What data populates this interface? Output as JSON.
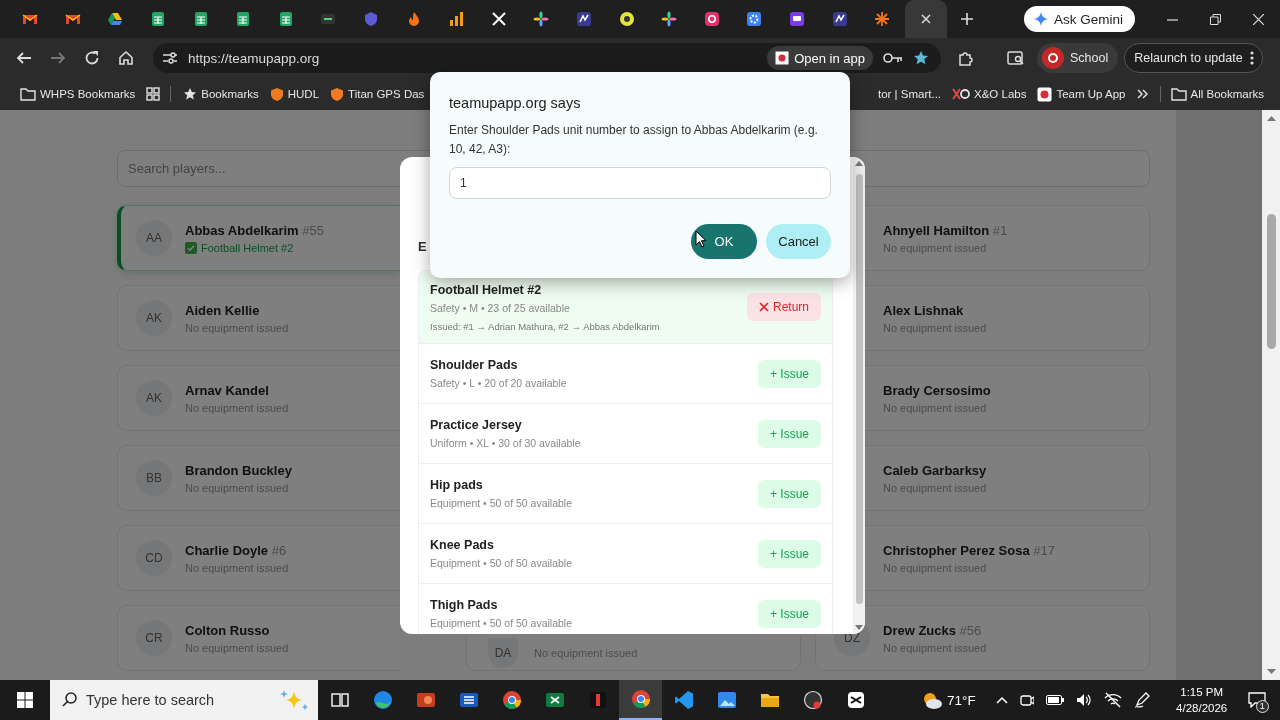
{
  "browser": {
    "tabs": [
      {
        "kind": "gmail",
        "selected": false
      },
      {
        "kind": "gmail",
        "selected": false
      },
      {
        "kind": "drive",
        "selected": false
      },
      {
        "kind": "sheets",
        "selected": false
      },
      {
        "kind": "sheets",
        "selected": false
      },
      {
        "kind": "sheets",
        "selected": false
      },
      {
        "kind": "sheets",
        "selected": false
      },
      {
        "kind": "dash",
        "selected": false
      },
      {
        "kind": "shield",
        "selected": false
      },
      {
        "kind": "flame",
        "selected": false
      },
      {
        "kind": "bars",
        "selected": false
      },
      {
        "kind": "x",
        "selected": false
      },
      {
        "kind": "pinwheel",
        "selected": false
      },
      {
        "kind": "badge",
        "selected": false
      },
      {
        "kind": "lemon",
        "selected": false
      },
      {
        "kind": "pinwheel",
        "selected": false
      },
      {
        "kind": "instagram",
        "selected": false
      },
      {
        "kind": "gear",
        "selected": false
      },
      {
        "kind": "chat",
        "selected": false
      },
      {
        "kind": "badge",
        "selected": false
      },
      {
        "kind": "burst",
        "selected": false
      },
      {
        "kind": "blank",
        "selected": true
      }
    ],
    "gemini": "Ask Gemini",
    "url": "https://teamupapp.org",
    "open_in_app": "Open in app",
    "profile": "School",
    "relaunch": "Relaunch to update",
    "bookmarks": [
      {
        "kind": "folder",
        "label": "WHPS Bookmarks"
      },
      {
        "kind": "apps"
      },
      {
        "kind": "star",
        "label": "Bookmarks"
      },
      {
        "kind": "shield",
        "label": "HUDL"
      },
      {
        "kind": "shield",
        "label": "Titan GPS Das"
      },
      {
        "kind": "plain",
        "label": "tor | Smart..."
      },
      {
        "kind": "xo",
        "label": "X&O Labs"
      },
      {
        "kind": "site",
        "label": "Team Up App"
      }
    ],
    "all_bookmarks": "All Bookmarks"
  },
  "page": {
    "search": {
      "placeholder": "Search players..."
    },
    "player_columns": [
      {
        "players": [
          {
            "initials": "AA",
            "name": "Abbas Abdelkarim",
            "number": "#55",
            "issued": "Football Helmet #2",
            "selected": true
          },
          {
            "initials": "AK",
            "name": "Aiden Kellie",
            "status": "No equipment issued",
            "selected": false
          },
          {
            "initials": "AK",
            "name": "Arnav Kandel",
            "status": "No equipment issued",
            "selected": false
          },
          {
            "initials": "BB",
            "name": "Brandon Buckley",
            "status": "No equipment issued",
            "selected": false
          },
          {
            "initials": "CD",
            "name": "Charlie Doyle",
            "number": "#6",
            "status": "No equipment issued",
            "selected": false
          },
          {
            "initials": "CR",
            "name": "Colton Russo",
            "status": "No equipment issued",
            "selected": false
          }
        ]
      },
      {
        "players": [
          {
            "initials": "DA",
            "status": "No equipment issued",
            "selected": false
          }
        ]
      },
      {
        "players": [
          {
            "name": "Ahnyell Hamilton",
            "number": "#1",
            "status": "No equipment issued"
          },
          {
            "name": "Alex Lishnak",
            "status": "No equipment issued"
          },
          {
            "name": "Brady Cersosimo",
            "status": "No equipment issued"
          },
          {
            "name": "Caleb Garbarksy",
            "status": "No equipment issued"
          },
          {
            "name": "Christopher Perez Sosa",
            "number": "#17",
            "status": "No equipment issued"
          },
          {
            "initials": "DZ",
            "name": "Drew Zucks",
            "number": "#56",
            "status": "No equipment issued"
          }
        ]
      }
    ]
  },
  "modal": {
    "heading": "E",
    "items": [
      {
        "name": "Football Helmet #2",
        "meta": "Safety • M • 23 of 25 available",
        "issued_to": "Issued: #1 → Adrian Mathura, #2 → Abbas Abdelkarim",
        "issued": true,
        "action": "Return"
      },
      {
        "name": "Shoulder Pads",
        "meta": "Safety • L • 20 of 20 available",
        "issued": false,
        "action": "+ Issue"
      },
      {
        "name": "Practice Jersey",
        "meta": "Uniform • XL • 30 of 30 available",
        "issued": false,
        "action": "+ Issue"
      },
      {
        "name": "Hip pads",
        "meta": "Equipment • 50 of 50 available",
        "issued": false,
        "action": "+ Issue"
      },
      {
        "name": "Knee Pads",
        "meta": "Equipment • 50 of 50 available",
        "issued": false,
        "action": "+ Issue"
      },
      {
        "name": "Thigh Pads",
        "meta": "Equipment • 50 of 50 available",
        "issued": false,
        "action": "+ Issue"
      }
    ]
  },
  "dialog": {
    "title": "teamupapp.org says",
    "message": "Enter Shoulder Pads unit number to assign to Abbas Abdelkarim (e.g. 10, 42, A3):",
    "value": "1",
    "ok": "OK",
    "cancel": "Cancel"
  },
  "taskbar": {
    "search_placeholder": "Type here to search",
    "apps": [
      {
        "kind": "task_view",
        "selected": false
      },
      {
        "kind": "edge",
        "selected": false
      },
      {
        "kind": "powerpoint",
        "selected": false
      },
      {
        "kind": "word",
        "selected": false
      },
      {
        "kind": "chrome",
        "selected": false
      },
      {
        "kind": "excel",
        "selected": false
      },
      {
        "kind": "red_app",
        "selected": false
      },
      {
        "kind": "chrome",
        "selected": true
      },
      {
        "kind": "vscode",
        "selected": false
      },
      {
        "kind": "photos",
        "selected": false
      },
      {
        "kind": "explorer",
        "selected": false
      },
      {
        "kind": "obs",
        "selected": false
      },
      {
        "kind": "capcut",
        "selected": false
      }
    ],
    "weather": "71°F",
    "time": "1:15 PM",
    "date": "4/28/2026",
    "notifications": "1"
  }
}
